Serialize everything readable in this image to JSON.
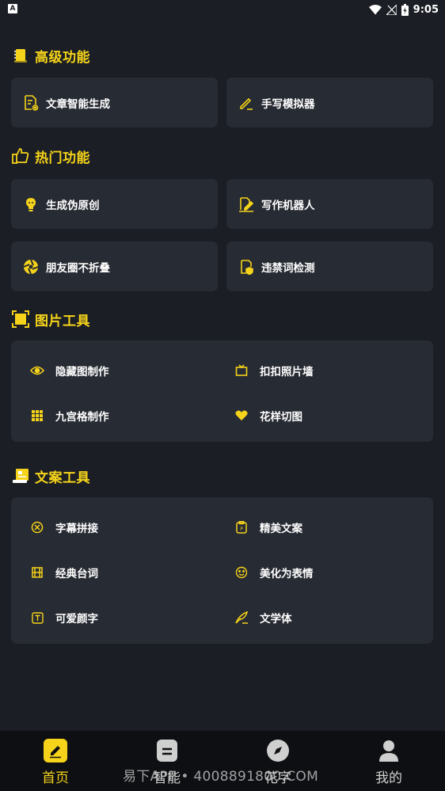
{
  "status_bar": {
    "time": "9:05",
    "left_badge": "A"
  },
  "sections": {
    "advanced": {
      "title": "高级功能",
      "cards": [
        {
          "label": "文章智能生成",
          "icon": "document-gear-icon"
        },
        {
          "label": "手写模拟器",
          "icon": "pen-icon"
        }
      ]
    },
    "popular": {
      "title": "热门功能",
      "cards": [
        {
          "label": "生成伪原创",
          "icon": "lightbulb-icon"
        },
        {
          "label": "写作机器人",
          "icon": "writing-robot-icon"
        },
        {
          "label": "朋友圈不折叠",
          "icon": "aperture-icon"
        },
        {
          "label": "违禁词检测",
          "icon": "shield-check-icon"
        }
      ]
    },
    "image_tools": {
      "title": "图片工具",
      "items": [
        {
          "label": "隐藏图制作",
          "icon": "eye-icon"
        },
        {
          "label": "扣扣照片墙",
          "icon": "frame-icon"
        },
        {
          "label": "九宫格制作",
          "icon": "grid-icon"
        },
        {
          "label": "花样切图",
          "icon": "heart-icon"
        }
      ]
    },
    "copy_tools": {
      "title": "文案工具",
      "items": [
        {
          "label": "字幕拼接",
          "icon": "subtitle-icon"
        },
        {
          "label": "精美文案",
          "icon": "clipboard-icon"
        },
        {
          "label": "经典台词",
          "icon": "film-icon"
        },
        {
          "label": "美化为表情",
          "icon": "smile-icon"
        },
        {
          "label": "可爱颜字",
          "icon": "text-box-icon"
        },
        {
          "label": "文学体",
          "icon": "quill-icon"
        }
      ]
    }
  },
  "tab_bar": {
    "tabs": [
      {
        "label": "首页",
        "icon": "edit-icon",
        "active": true
      },
      {
        "label": "智能",
        "icon": "list-icon",
        "active": false
      },
      {
        "label": "花字",
        "icon": "compass-icon",
        "active": false
      },
      {
        "label": "我的",
        "icon": "user-icon",
        "active": false
      }
    ]
  },
  "watermark": "易下APP • 4008891800.COM",
  "colors": {
    "accent": "#f5d31a",
    "background": "#1b1e24",
    "card": "#272b33",
    "tabbar": "#0e0f12"
  }
}
